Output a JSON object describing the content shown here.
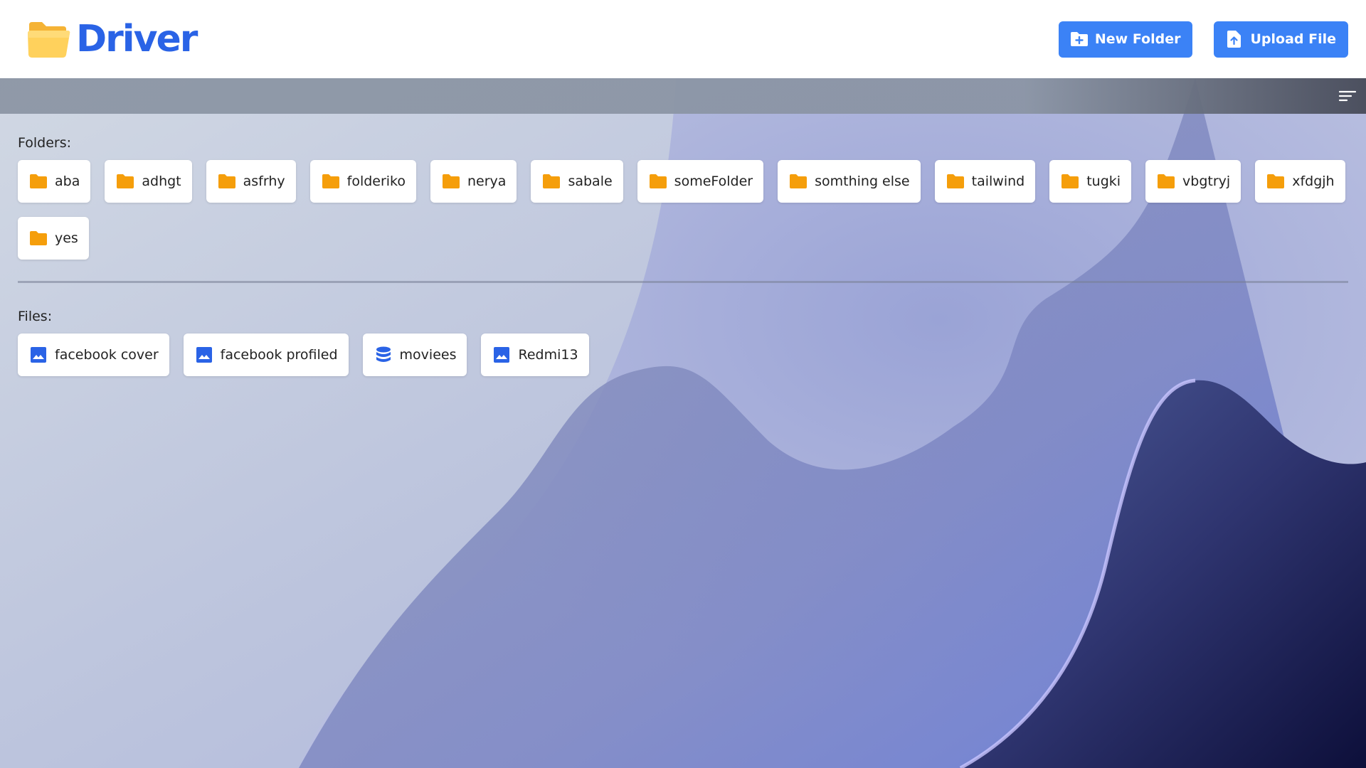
{
  "app": {
    "title": "Driver",
    "logo_icon": "open-folder-icon",
    "brand_color": "#2a63e6"
  },
  "header": {
    "new_folder_label": "New Folder",
    "new_folder_icon": "folder-plus-icon",
    "upload_file_label": "Upload File",
    "upload_file_icon": "file-upload-icon",
    "button_color": "#3b82f6"
  },
  "toolbar": {
    "sort_icon": "sort-lines-icon"
  },
  "folders": {
    "label": "Folders:",
    "icon": "folder-icon",
    "icon_color": "#f59e0b",
    "items": [
      {
        "name": "aba"
      },
      {
        "name": "adhgt"
      },
      {
        "name": "asfrhy"
      },
      {
        "name": "folderiko"
      },
      {
        "name": "nerya"
      },
      {
        "name": "sabale"
      },
      {
        "name": "someFolder"
      },
      {
        "name": "somthing else"
      },
      {
        "name": "tailwind"
      },
      {
        "name": "tugki"
      },
      {
        "name": "vbgtryj"
      },
      {
        "name": "xfdgjh"
      },
      {
        "name": "yes"
      }
    ]
  },
  "files": {
    "label": "Files:",
    "icon_color": "#2a63e6",
    "items": [
      {
        "name": "facebook cover",
        "icon": "image-icon"
      },
      {
        "name": "facebook profiled",
        "icon": "image-icon"
      },
      {
        "name": "moviees",
        "icon": "database-icon"
      },
      {
        "name": "Redmi13",
        "icon": "image-icon"
      }
    ]
  }
}
